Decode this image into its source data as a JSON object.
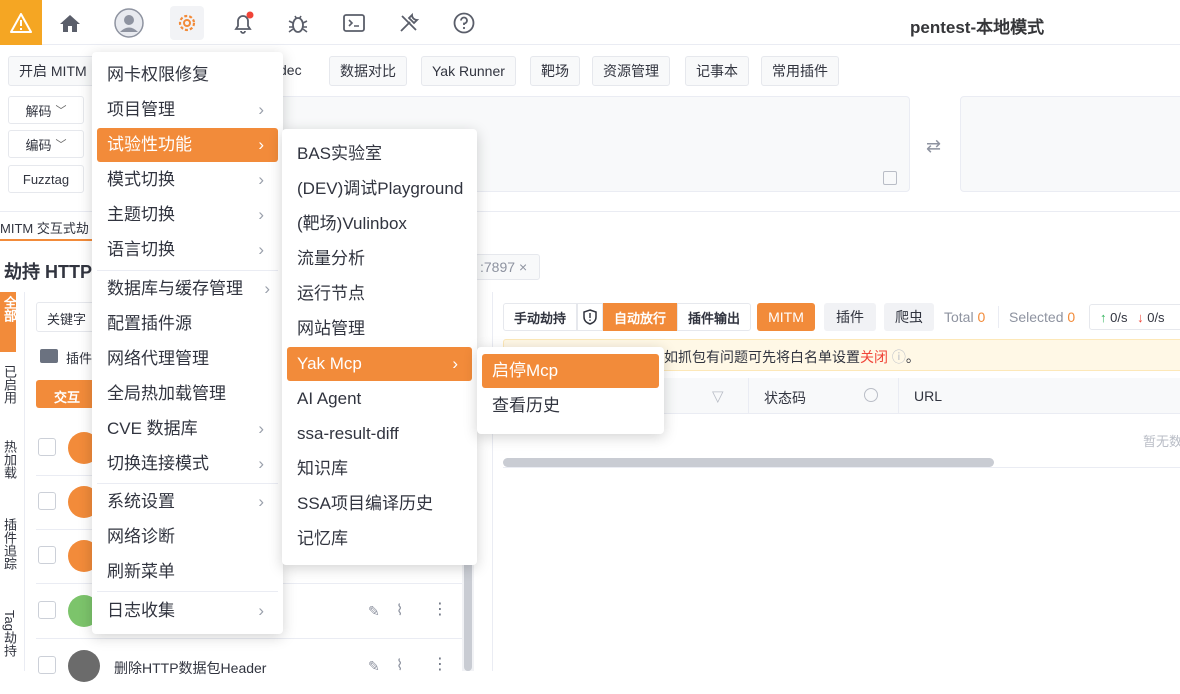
{
  "app_title": "pentest-本地模式",
  "top_icons": [
    "home-icon",
    "user-icon",
    "gear-icon",
    "bell-icon",
    "bug-icon",
    "terminal-icon",
    "tools-icon",
    "help-icon"
  ],
  "tabs": [
    "开启 MITM",
    "dec",
    "数据对比",
    "Yak Runner",
    "靶场",
    "资源管理",
    "记事本",
    "常用插件"
  ],
  "codec": {
    "decode": "解码",
    "encode": "编码",
    "fuzztag": "Fuzztag"
  },
  "left": {
    "mitm_tab": "MITM 交互式劫",
    "hijack_title": "劫持 HTTP",
    "vertical_tabs": [
      "全部",
      "已启用",
      "热加载",
      "插件追踪",
      "Tag劫持"
    ],
    "keyword_select": "关键字",
    "plugin_folder_label": "插件",
    "interactive_button": "交互",
    "last_plugin_name": "删除HTTP数据包Header"
  },
  "right": {
    "proxy_tag": ":7897",
    "buttons": {
      "manual": "手动劫持",
      "auto": "自动放行",
      "plugin_output": "插件输出",
      "mitm": "MITM",
      "plugin": "插件",
      "crawler": "爬虫"
    },
    "total_label": "Total",
    "total_value": "0",
    "selected_label": "Selected",
    "selected_value": "0",
    "up_rate": "0/s",
    "down_rate": "0/s",
    "notice_text": "如抓包有问题可先将白名单设置",
    "notice_link": "关闭",
    "notice_end": "。",
    "col_status": "状态码",
    "col_url": "URL",
    "empty_text": "暂无数"
  },
  "menu_main": {
    "items": [
      {
        "label": "网卡权限修复"
      },
      {
        "label": "项目管理"
      },
      {
        "label": "试验性功能"
      },
      {
        "label": "模式切换"
      },
      {
        "label": "主题切换"
      },
      {
        "label": "语言切换"
      },
      {
        "label": "数据库与缓存管理"
      },
      {
        "label": "配置插件源"
      },
      {
        "label": "网络代理管理"
      },
      {
        "label": "全局热加载管理"
      },
      {
        "label": "CVE 数据库"
      },
      {
        "label": "切换连接模式"
      },
      {
        "label": "系统设置"
      },
      {
        "label": "网络诊断"
      },
      {
        "label": "刷新菜单"
      },
      {
        "label": "日志收集"
      }
    ],
    "highlighted": "试验性功能"
  },
  "menu_experimental": {
    "items": [
      {
        "label": "BAS实验室"
      },
      {
        "label": "(DEV)调试Playground"
      },
      {
        "label": "(靶场)Vulinbox"
      },
      {
        "label": "流量分析"
      },
      {
        "label": "运行节点"
      },
      {
        "label": "网站管理"
      },
      {
        "label": "Yak Mcp"
      },
      {
        "label": "AI Agent"
      },
      {
        "label": "ssa-result-diff"
      },
      {
        "label": "知识库"
      },
      {
        "label": "SSA项目编译历史"
      },
      {
        "label": "记忆库"
      }
    ],
    "highlighted": "Yak Mcp"
  },
  "menu_mcp": {
    "items": [
      {
        "label": "启停Mcp"
      },
      {
        "label": "查看历史"
      }
    ],
    "highlighted": "启停Mcp"
  },
  "colors": {
    "accent": "#f28b3a",
    "warning": "#f5a623",
    "notice_bg": "#fff8e6",
    "danger": "#f04438"
  }
}
